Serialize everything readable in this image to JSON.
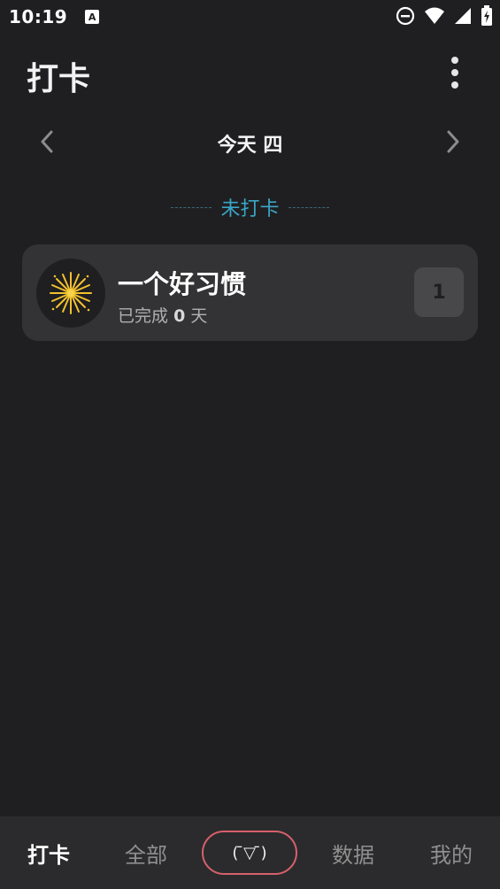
{
  "status_bar": {
    "time": "10:19",
    "notification_icon_letter": "A",
    "icons": [
      "do-not-disturb-icon",
      "wifi-icon",
      "signal-icon",
      "battery-charging-icon"
    ]
  },
  "header": {
    "title": "打卡",
    "more_icon": "more-vertical-icon"
  },
  "date_nav": {
    "label": "今天 四",
    "prev_icon": "chevron-left-icon",
    "next_icon": "chevron-right-icon"
  },
  "section": {
    "label": "未打卡",
    "accent_color": "#3aa6c7"
  },
  "habits": [
    {
      "name": "一个好习惯",
      "progress_prefix": "已完成",
      "progress_days": "0",
      "progress_suffix": "天",
      "count": "1",
      "icon": "sparkle-icon"
    }
  ],
  "bottom_nav": {
    "tabs": [
      {
        "label": "打卡",
        "active": true
      },
      {
        "label": "全部",
        "active": false
      },
      {
        "label": "( ̄▽ ̄)",
        "active": false
      },
      {
        "label": "数据",
        "active": false
      },
      {
        "label": "我的",
        "active": false
      }
    ],
    "center_border_color": "#d7606b"
  }
}
